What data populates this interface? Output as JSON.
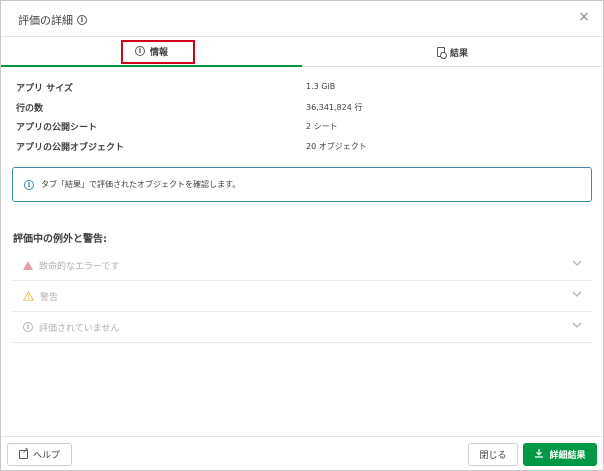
{
  "dialog": {
    "title": "評価の詳細",
    "close_symbol": "×"
  },
  "tabs": [
    {
      "label": "情報",
      "active": true,
      "icon": "info-icon"
    },
    {
      "label": "結果",
      "active": false,
      "icon": "results-doc-icon"
    }
  ],
  "properties": [
    {
      "label": "アプリ サイズ",
      "value": "1.3 GiB"
    },
    {
      "label": "行の数",
      "value": "36,341,824 行"
    },
    {
      "label": "アプリの公開シート",
      "value": "2 シート"
    },
    {
      "label": "アプリの公開オブジェクト",
      "value": "20 オブジェクト"
    }
  ],
  "notice": {
    "text": "タブ「結果」で評価されたオブジェクトを確認します。"
  },
  "exceptions": {
    "title": "評価中の例外と警告:",
    "items": [
      {
        "label": "致命的なエラーです",
        "icon": "error-triangle-icon"
      },
      {
        "label": "警告",
        "icon": "warning-triangle-icon"
      },
      {
        "label": "評価されていません",
        "icon": "info-icon"
      }
    ]
  },
  "footer": {
    "help_label": "ヘルプ",
    "close_label": "閉じる",
    "details_label": "詳細結果"
  },
  "colors": {
    "accent_green": "#009845",
    "highlight_red": "#d0021b",
    "notice_blue": "#3f8ab3"
  }
}
